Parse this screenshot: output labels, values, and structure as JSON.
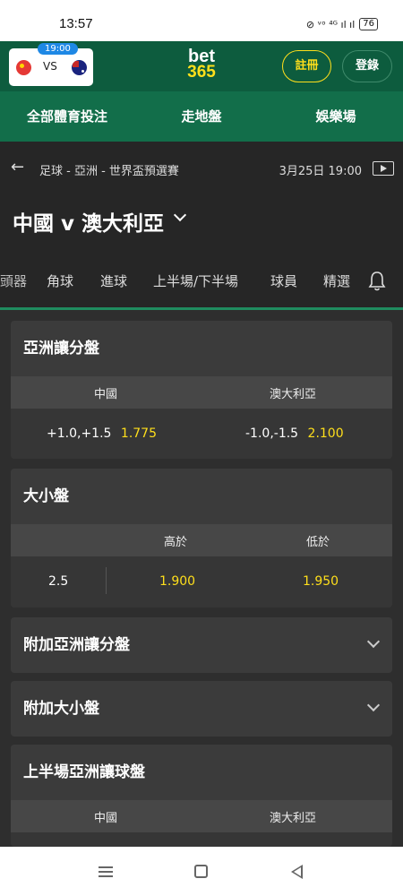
{
  "status_bar": {
    "time": "13:57",
    "icons_text": "⊘ ᵛᵒ ⁴ᴳ ıl ıl",
    "battery": "76"
  },
  "header": {
    "match_time": "19:00",
    "vs_label": "VS",
    "logo_line1": "bet",
    "logo_line2": "365",
    "register_label": "註冊",
    "login_label": "登錄"
  },
  "nav": [
    "全部體育投注",
    "走地盤",
    "娛樂場"
  ],
  "event": {
    "breadcrumb": "足球 - 亞洲 - 世界盃預選賽",
    "date": "3月25日 19:00",
    "title": "中國 v 澳大利亞"
  },
  "tabs": [
    "頭器",
    "角球",
    "進球",
    "上半場/下半場",
    "球員",
    "精選"
  ],
  "markets": {
    "asian_handicap": {
      "title": "亞洲讓分盤",
      "team1": "中國",
      "team2": "澳大利亞",
      "line1": "+1.0,+1.5",
      "odds1": "1.775",
      "line2": "-1.0,-1.5",
      "odds2": "2.100"
    },
    "totals": {
      "title": "大小盤",
      "over_label": "高於",
      "under_label": "低於",
      "line": "2.5",
      "over_odds": "1.900",
      "under_odds": "1.950"
    },
    "extra_asian": {
      "title": "附加亞洲讓分盤"
    },
    "extra_totals": {
      "title": "附加大小盤"
    },
    "first_half_ah": {
      "title": "上半場亞洲讓球盤",
      "team1": "中國",
      "team2": "澳大利亞"
    }
  },
  "colors": {
    "brand_green": "#126e4a",
    "accent_yellow": "#ffdf1b",
    "card_bg": "#363636"
  }
}
